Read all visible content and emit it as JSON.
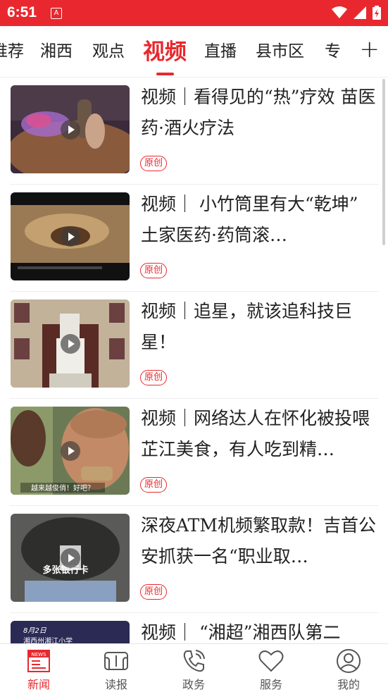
{
  "status_bar": {
    "time": "6:51",
    "app_icon_letter": "A"
  },
  "tabs": [
    {
      "label": "推荐",
      "display": "推荐"
    },
    {
      "label": "湘西"
    },
    {
      "label": "观点"
    },
    {
      "label": "视频",
      "active": true
    },
    {
      "label": "直播"
    },
    {
      "label": "县市区"
    },
    {
      "label": "专"
    }
  ],
  "tab_add_icon": "+",
  "feed": [
    {
      "title": "视频｜看得见的“热”疗效 苗医药·酒火疗法",
      "badge": "原创"
    },
    {
      "title": "视频｜ 小竹筒里有大“乾坤”   土家医药·药筒滚…",
      "badge": "原创"
    },
    {
      "title": "视频｜追星，就该追科技巨星！",
      "badge": "原创"
    },
    {
      "title": "视频｜网络达人在怀化被投喂芷江美食，有人吃到精…",
      "badge": "原创"
    },
    {
      "title": "深夜ATM机频繁取款！吉首公安抓获一名“职业取…",
      "badge": "原创"
    },
    {
      "title": "视频｜ “湘超”湘西队第二",
      "badge": ""
    }
  ],
  "thumb_captions": {
    "item2": "越来越俊俏！好吧？",
    "item4": "多张银行卡",
    "item5_top": "8月2日",
    "item5_sub": "湘西州湘江小学"
  },
  "bottom_nav": [
    {
      "label": "新闻",
      "icon": "news-icon",
      "active": true
    },
    {
      "label": "读报",
      "icon": "newspaper-icon"
    },
    {
      "label": "政务",
      "icon": "phone-icon"
    },
    {
      "label": "服务",
      "icon": "heart-icon"
    },
    {
      "label": "我的",
      "icon": "user-icon"
    }
  ],
  "colors": {
    "accent": "#e8282e"
  }
}
